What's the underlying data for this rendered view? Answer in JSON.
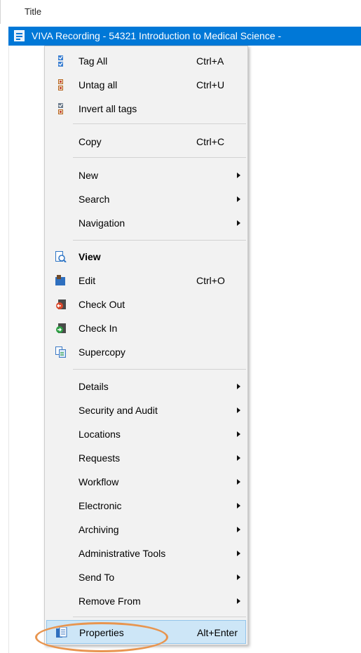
{
  "header": {
    "column_title": "Title"
  },
  "selected_row": {
    "text": "VIVA Recording - 54321 Introduction to Medical Science -",
    "icon": "document-icon"
  },
  "menu": {
    "items": [
      {
        "label": "Tag All",
        "shortcut": "Ctrl+A",
        "icon": "tag-all-icon"
      },
      {
        "label": "Untag all",
        "shortcut": "Ctrl+U",
        "icon": "untag-all-icon"
      },
      {
        "label": "Invert all tags",
        "shortcut": "",
        "icon": "invert-tags-icon"
      },
      {
        "label": "Copy",
        "shortcut": "Ctrl+C"
      },
      {
        "label": "New",
        "submenu": true
      },
      {
        "label": "Search",
        "submenu": true
      },
      {
        "label": "Navigation",
        "submenu": true
      },
      {
        "label": "View",
        "bold": true,
        "icon": "view-icon"
      },
      {
        "label": "Edit",
        "shortcut": "Ctrl+O",
        "icon": "edit-icon"
      },
      {
        "label": "Check Out",
        "icon": "check-out-icon"
      },
      {
        "label": "Check In",
        "icon": "check-in-icon"
      },
      {
        "label": "Supercopy",
        "icon": "supercopy-icon"
      },
      {
        "label": "Details",
        "submenu": true
      },
      {
        "label": "Security and Audit",
        "submenu": true
      },
      {
        "label": "Locations",
        "submenu": true
      },
      {
        "label": "Requests",
        "submenu": true
      },
      {
        "label": "Workflow",
        "submenu": true
      },
      {
        "label": "Electronic",
        "submenu": true
      },
      {
        "label": "Archiving",
        "submenu": true
      },
      {
        "label": "Administrative Tools",
        "submenu": true
      },
      {
        "label": "Send To",
        "submenu": true
      },
      {
        "label": "Remove From",
        "submenu": true
      },
      {
        "label": "Properties",
        "shortcut": "Alt+Enter",
        "icon": "properties-icon",
        "highlighted": true
      }
    ]
  },
  "colors": {
    "selection": "#0078d7",
    "menu_bg": "#f2f2f2",
    "highlight": "#cde6f7",
    "annotation": "#e8954f"
  }
}
